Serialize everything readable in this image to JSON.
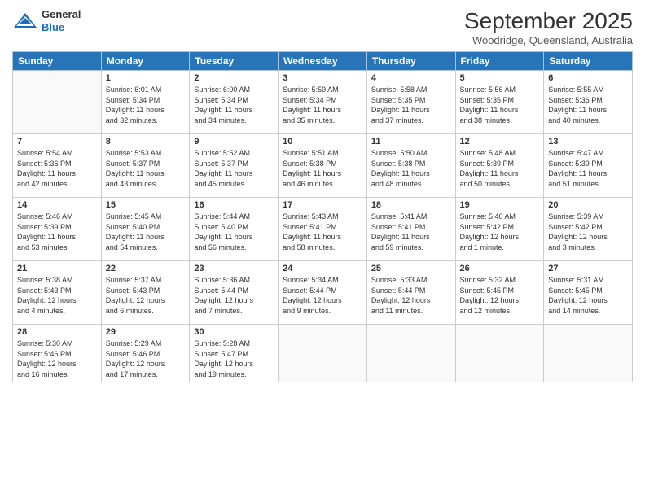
{
  "header": {
    "logo": {
      "line1": "General",
      "line2": "Blue"
    },
    "title": "September 2025",
    "location": "Woodridge, Queensland, Australia"
  },
  "weekdays": [
    "Sunday",
    "Monday",
    "Tuesday",
    "Wednesday",
    "Thursday",
    "Friday",
    "Saturday"
  ],
  "weeks": [
    [
      {
        "day": "",
        "info": ""
      },
      {
        "day": "1",
        "info": "Sunrise: 6:01 AM\nSunset: 5:34 PM\nDaylight: 11 hours\nand 32 minutes."
      },
      {
        "day": "2",
        "info": "Sunrise: 6:00 AM\nSunset: 5:34 PM\nDaylight: 11 hours\nand 34 minutes."
      },
      {
        "day": "3",
        "info": "Sunrise: 5:59 AM\nSunset: 5:34 PM\nDaylight: 11 hours\nand 35 minutes."
      },
      {
        "day": "4",
        "info": "Sunrise: 5:58 AM\nSunset: 5:35 PM\nDaylight: 11 hours\nand 37 minutes."
      },
      {
        "day": "5",
        "info": "Sunrise: 5:56 AM\nSunset: 5:35 PM\nDaylight: 11 hours\nand 38 minutes."
      },
      {
        "day": "6",
        "info": "Sunrise: 5:55 AM\nSunset: 5:36 PM\nDaylight: 11 hours\nand 40 minutes."
      }
    ],
    [
      {
        "day": "7",
        "info": "Sunrise: 5:54 AM\nSunset: 5:36 PM\nDaylight: 11 hours\nand 42 minutes."
      },
      {
        "day": "8",
        "info": "Sunrise: 5:53 AM\nSunset: 5:37 PM\nDaylight: 11 hours\nand 43 minutes."
      },
      {
        "day": "9",
        "info": "Sunrise: 5:52 AM\nSunset: 5:37 PM\nDaylight: 11 hours\nand 45 minutes."
      },
      {
        "day": "10",
        "info": "Sunrise: 5:51 AM\nSunset: 5:38 PM\nDaylight: 11 hours\nand 46 minutes."
      },
      {
        "day": "11",
        "info": "Sunrise: 5:50 AM\nSunset: 5:38 PM\nDaylight: 11 hours\nand 48 minutes."
      },
      {
        "day": "12",
        "info": "Sunrise: 5:48 AM\nSunset: 5:39 PM\nDaylight: 11 hours\nand 50 minutes."
      },
      {
        "day": "13",
        "info": "Sunrise: 5:47 AM\nSunset: 5:39 PM\nDaylight: 11 hours\nand 51 minutes."
      }
    ],
    [
      {
        "day": "14",
        "info": "Sunrise: 5:46 AM\nSunset: 5:39 PM\nDaylight: 11 hours\nand 53 minutes."
      },
      {
        "day": "15",
        "info": "Sunrise: 5:45 AM\nSunset: 5:40 PM\nDaylight: 11 hours\nand 54 minutes."
      },
      {
        "day": "16",
        "info": "Sunrise: 5:44 AM\nSunset: 5:40 PM\nDaylight: 11 hours\nand 56 minutes."
      },
      {
        "day": "17",
        "info": "Sunrise: 5:43 AM\nSunset: 5:41 PM\nDaylight: 11 hours\nand 58 minutes."
      },
      {
        "day": "18",
        "info": "Sunrise: 5:41 AM\nSunset: 5:41 PM\nDaylight: 11 hours\nand 59 minutes."
      },
      {
        "day": "19",
        "info": "Sunrise: 5:40 AM\nSunset: 5:42 PM\nDaylight: 12 hours\nand 1 minute."
      },
      {
        "day": "20",
        "info": "Sunrise: 5:39 AM\nSunset: 5:42 PM\nDaylight: 12 hours\nand 3 minutes."
      }
    ],
    [
      {
        "day": "21",
        "info": "Sunrise: 5:38 AM\nSunset: 5:43 PM\nDaylight: 12 hours\nand 4 minutes."
      },
      {
        "day": "22",
        "info": "Sunrise: 5:37 AM\nSunset: 5:43 PM\nDaylight: 12 hours\nand 6 minutes."
      },
      {
        "day": "23",
        "info": "Sunrise: 5:36 AM\nSunset: 5:44 PM\nDaylight: 12 hours\nand 7 minutes."
      },
      {
        "day": "24",
        "info": "Sunrise: 5:34 AM\nSunset: 5:44 PM\nDaylight: 12 hours\nand 9 minutes."
      },
      {
        "day": "25",
        "info": "Sunrise: 5:33 AM\nSunset: 5:44 PM\nDaylight: 12 hours\nand 11 minutes."
      },
      {
        "day": "26",
        "info": "Sunrise: 5:32 AM\nSunset: 5:45 PM\nDaylight: 12 hours\nand 12 minutes."
      },
      {
        "day": "27",
        "info": "Sunrise: 5:31 AM\nSunset: 5:45 PM\nDaylight: 12 hours\nand 14 minutes."
      }
    ],
    [
      {
        "day": "28",
        "info": "Sunrise: 5:30 AM\nSunset: 5:46 PM\nDaylight: 12 hours\nand 16 minutes."
      },
      {
        "day": "29",
        "info": "Sunrise: 5:29 AM\nSunset: 5:46 PM\nDaylight: 12 hours\nand 17 minutes."
      },
      {
        "day": "30",
        "info": "Sunrise: 5:28 AM\nSunset: 5:47 PM\nDaylight: 12 hours\nand 19 minutes."
      },
      {
        "day": "",
        "info": ""
      },
      {
        "day": "",
        "info": ""
      },
      {
        "day": "",
        "info": ""
      },
      {
        "day": "",
        "info": ""
      }
    ]
  ]
}
